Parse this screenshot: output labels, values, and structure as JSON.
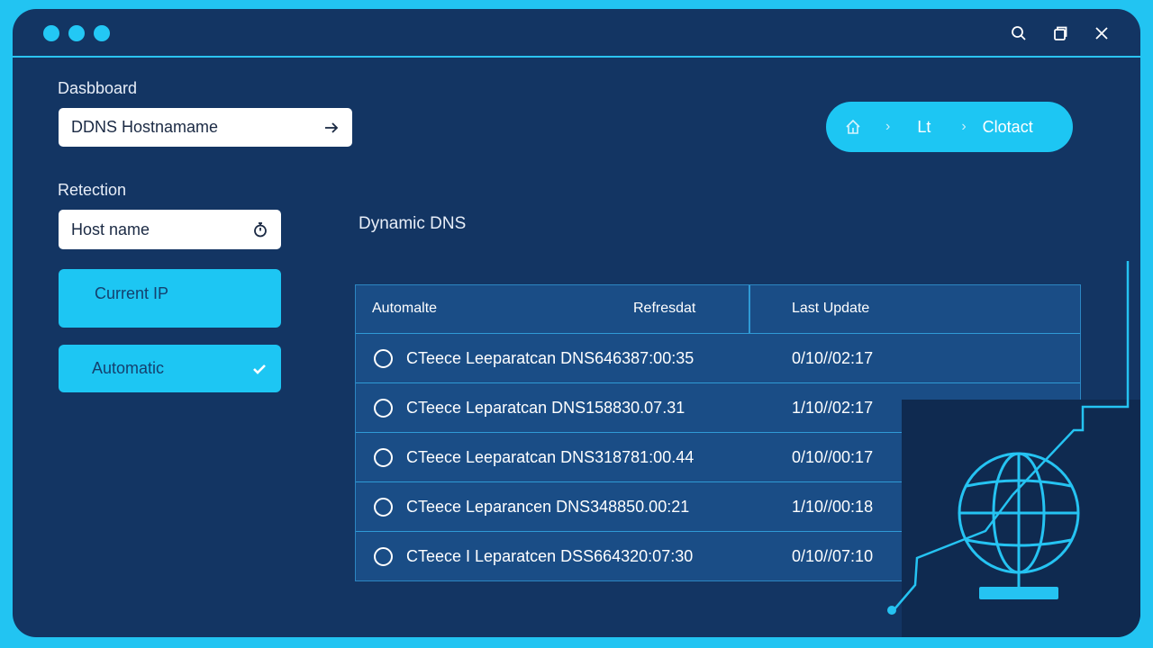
{
  "window": {
    "controls": [
      "search-icon",
      "restore-icon",
      "close-icon"
    ],
    "accent_color": "#1dc6f3",
    "background_color": "#133563"
  },
  "sidebar": {
    "dashboard_label": "Dasbboard",
    "hostname_field_value": "DDNS Hostnamame",
    "retection_label": "Retection",
    "host_field_value": "Host name",
    "current_ip_label": "Current IP",
    "automatic_label": "Automatic"
  },
  "breadcrumb": {
    "items": [
      "Lt",
      "Clotact"
    ],
    "home_icon": "home-icon"
  },
  "panel": {
    "title": "Dynamic DNS"
  },
  "table": {
    "columns": [
      "Automalte",
      "Refresdat",
      "Last Update"
    ],
    "rows": [
      {
        "entry": "CTeece Leeparatcan DNS646387:00:35",
        "last_update": "0/10//02:17"
      },
      {
        "entry": "CTeece Leparatcan DNS158830.07.31",
        "last_update": "1/10//02:17"
      },
      {
        "entry": "CTeece Leeparatcan DNS318781:00.44",
        "last_update": "0/10//00:17"
      },
      {
        "entry": "CTeece Leparancen DNS348850.00:21",
        "last_update": "1/10//00:18"
      },
      {
        "entry": "CTeece I Leparatcen DSS664320:07:30",
        "last_update": "0/10//07:10"
      }
    ]
  },
  "illustration": {
    "icon": "globe-icon"
  }
}
